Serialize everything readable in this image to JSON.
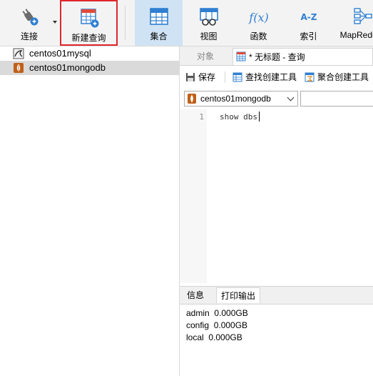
{
  "toolbar": {
    "connect_label": "连接",
    "new_query_label": "新建查询",
    "collection_label": "集合",
    "view_label": "视图",
    "function_label": "函数",
    "index_label": "索引",
    "mapreduce_label": "MapReduce",
    "function_glyph": "f(x)",
    "index_glyph": "A-Z",
    "colors": {
      "active_bg": "#cfe3f4",
      "highlight_border": "#e0262b",
      "icon_blue": "#2f7fd1"
    }
  },
  "tree": {
    "items": [
      {
        "label": "centos01mysql",
        "icon": "mysql-icon"
      },
      {
        "label": "centos01mongodb",
        "icon": "mongodb-icon",
        "selected": true
      }
    ]
  },
  "tabs": {
    "objects_label": "对象",
    "query_label": "* 无标题 - 查询"
  },
  "query_toolbar": {
    "save_label": "保存",
    "find_builder_label": "查找创建工具",
    "aggregate_builder_label": "聚合创建工具"
  },
  "connection_select": {
    "value": "centos01mongodb"
  },
  "editor": {
    "lines": [
      {
        "number": "1",
        "text": "show dbs"
      }
    ]
  },
  "output_tabs": {
    "info_label": "信息",
    "print_label": "打印输出"
  },
  "output": {
    "lines": [
      "admin  0.000GB",
      "config  0.000GB",
      "local  0.000GB"
    ]
  }
}
